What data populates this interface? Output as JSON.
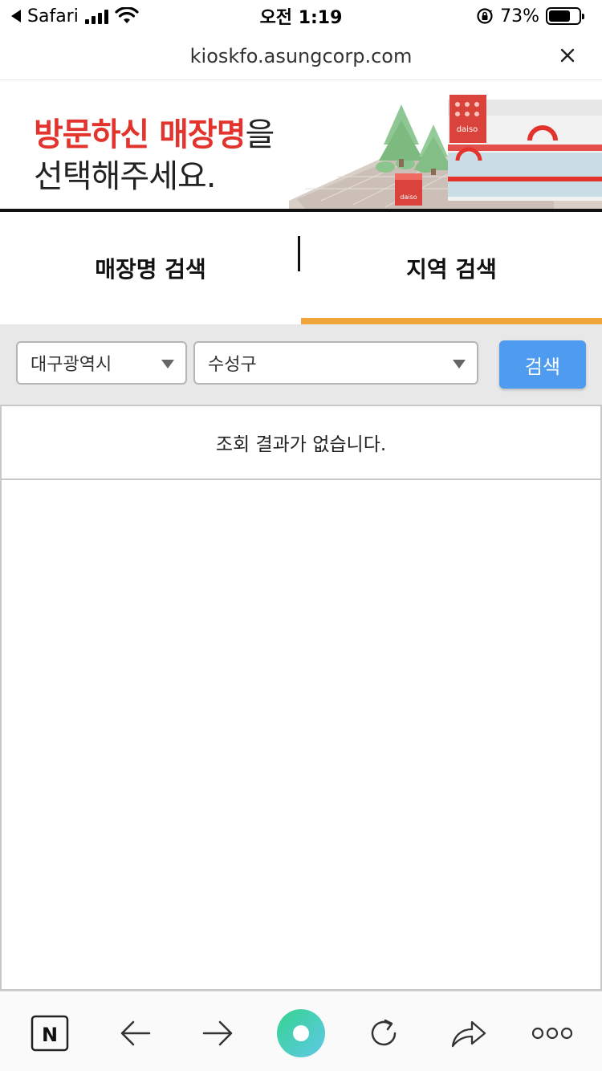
{
  "status_bar": {
    "back_app": "Safari",
    "time": "오전 1:19",
    "battery": "73%",
    "battery_fraction": 0.73
  },
  "url_bar": {
    "url": "kioskfo.asungcorp.com"
  },
  "banner": {
    "line1_red": "방문하신 매장명",
    "line1_dark": "을",
    "line2": "선택해주세요.",
    "brand": "daiso"
  },
  "tabs": [
    {
      "label": "매장명 검색",
      "active": false
    },
    {
      "label": "지역 검색",
      "active": true
    }
  ],
  "filters": {
    "region": "대구광역시",
    "district": "수성구",
    "search_label": "검색"
  },
  "results": {
    "empty_message": "조회 결과가 없습니다."
  },
  "toolbar": {
    "naver_label": "N"
  },
  "colors": {
    "accent_orange": "#f0a53a",
    "search_blue": "#4e9bef",
    "brand_red": "#e2332d"
  }
}
